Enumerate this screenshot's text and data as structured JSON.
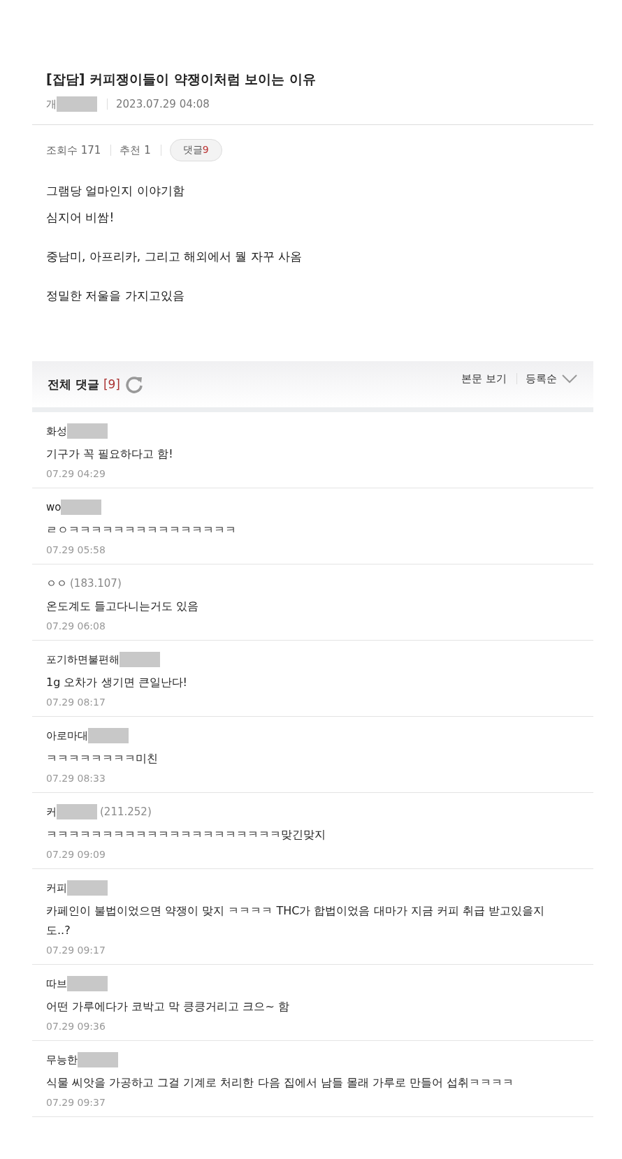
{
  "post": {
    "category": "[잡담]",
    "title": "커피쟁이들이 약쟁이처럼 보이는 이유",
    "author": "개",
    "author_redacted": true,
    "date": "2023.07.29 04:08",
    "stats": [
      {
        "label": "조회수",
        "value": "171"
      },
      {
        "label": "추천",
        "value": "1"
      }
    ],
    "comment_chip": {
      "label": "댓글",
      "count": "9"
    },
    "body_paragraphs": [
      [
        "그램당 얼마인지 이야기함",
        "심지어 비쌈!"
      ],
      [
        "중남미, 아프리카, 그리고 해외에서 뭘 자꾸 사옴"
      ],
      [
        "정밀한 저울을 가지고있음"
      ]
    ]
  },
  "comments_header": {
    "title": "전체 댓글",
    "count": "[9]",
    "view_post": "본문 보기",
    "sort": "등록순"
  },
  "comments": [
    {
      "nick": "화성",
      "redacted": true,
      "text": "기구가 꼭 필요하다고 함!",
      "time": "07.29 04:29"
    },
    {
      "nick": "wo",
      "redacted": true,
      "text": "ㄹㅇㅋㅋㅋㅋㅋㅋㅋㅋㅋㅋㅋㅋㅋㅋㅋ",
      "time": "07.29 05:58"
    },
    {
      "nick": "ㅇㅇ",
      "redacted": false,
      "ip": "(183.107)",
      "text": "온도계도 들고다니는거도 있음",
      "time": "07.29 06:08"
    },
    {
      "nick": "포기하면불편해",
      "redacted": true,
      "text": "1g 오차가 생기면 큰일난다!",
      "time": "07.29 08:17"
    },
    {
      "nick": "아로마대",
      "redacted": true,
      "text": "ㅋㅋㅋㅋㅋㅋㅋㅋ미친",
      "time": "07.29 08:33"
    },
    {
      "nick": "커",
      "redacted": true,
      "ip": "(211.252)",
      "text": "ㅋㅋㅋㅋㅋㅋㅋㅋㅋㅋㅋㅋㅋㅋㅋㅋㅋㅋㅋㅋㅋ맞긴맞지",
      "time": "07.29 09:09"
    },
    {
      "nick": "커피",
      "redacted": true,
      "text": "카페인이 불법이었으면 약쟁이 맞지 ㅋㅋㅋㅋ THC가 합법이었음 대마가 지금 커피 취급 받고있을지도..?",
      "time": "07.29 09:17"
    },
    {
      "nick": "따브",
      "redacted": true,
      "text": "어떤 가루에다가 코박고 막 킁킁거리고 크으~ 함",
      "time": "07.29 09:36"
    },
    {
      "nick": "무능한",
      "redacted": true,
      "text": "식물 씨앗을 가공하고 그걸 기계로 처리한 다음 집에서 남들 몰래 가루로 만들어 섭취ㅋㅋㅋㅋ",
      "time": "07.29 09:37"
    }
  ]
}
